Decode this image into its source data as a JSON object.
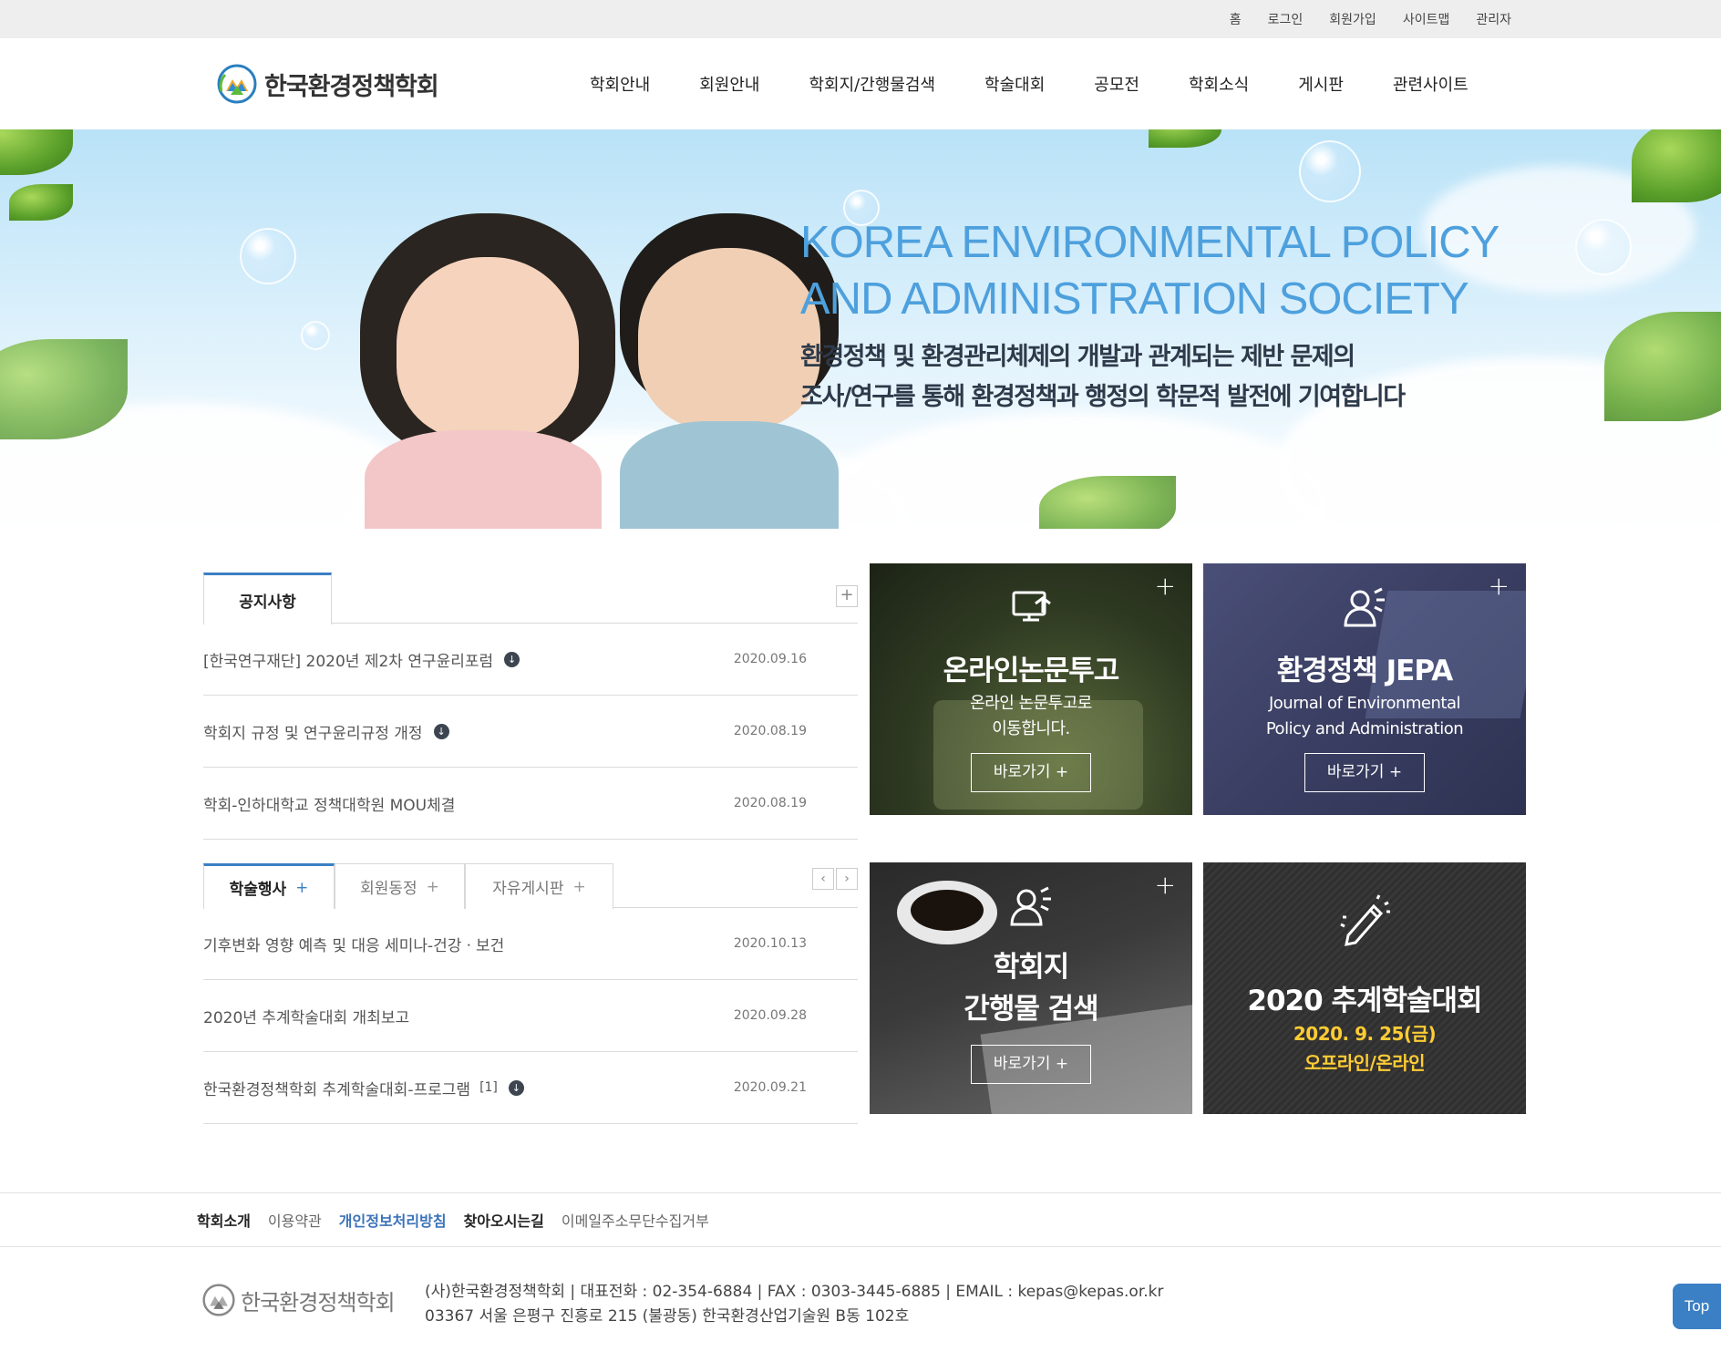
{
  "util_nav": [
    "홈",
    "로그인",
    "회원가입",
    "사이트맵",
    "관리자"
  ],
  "logo": {
    "name": "한국환경정책학회"
  },
  "gnb": [
    "학회안내",
    "회원안내",
    "학회지/간행물검색",
    "학술대회",
    "공모전",
    "학회소식",
    "게시판",
    "관련사이트"
  ],
  "hero": {
    "title_line1": "KOREA ENVIRONMENTAL POLICY",
    "title_line2": "AND ADMINISTRATION SOCIETY",
    "sub_line1": "환경정책 및 환경관리체제의 개발과 관계되는 제반 문제의",
    "sub_line2": "조사/연구를 통해 환경정책과 행정의 학문적 발전에 기여합니다"
  },
  "notice": {
    "tab": "공지사항",
    "more": "+",
    "items": [
      {
        "title": "[한국연구재단] 2020년 제2차 연구윤리포럼",
        "date": "2020.09.16",
        "has_file": true
      },
      {
        "title": "학회지 규정 및 연구윤리규정 개정",
        "date": "2020.08.19",
        "has_file": true
      },
      {
        "title": "학회-인하대학교 정책대학원 MOU체결",
        "date": "2020.08.19",
        "has_file": false
      }
    ]
  },
  "events": {
    "tabs": [
      {
        "label": "학술행사",
        "plus": "+"
      },
      {
        "label": "회원동정",
        "plus": "+"
      },
      {
        "label": "자유게시판",
        "plus": "+"
      }
    ],
    "prev": "‹",
    "next": "›",
    "items": [
      {
        "title": "기후변화 영향 예측 및 대응 세미나-건강ㆍ보건",
        "date": "2020.10.13",
        "count": "",
        "has_file": false
      },
      {
        "title": "2020년 추계학술대회 개최보고",
        "date": "2020.09.28",
        "count": "",
        "has_file": false
      },
      {
        "title": "한국환경정책학회 추계학술대회-프로그램",
        "date": "2020.09.21",
        "count": "[1]",
        "has_file": true
      }
    ]
  },
  "tiles": {
    "paper": {
      "title": "온라인논문투고",
      "desc1": "온라인 논문투고로",
      "desc2": "이동합니다.",
      "button": "바로가기 +",
      "plus": "+",
      "icon": "computer-upload-icon"
    },
    "jepa": {
      "title": "환경정책 JEPA",
      "desc1": "Journal of Environmental",
      "desc2": "Policy and Administration",
      "button": "바로가기 +",
      "plus": "+",
      "icon": "person-speaking-icon"
    },
    "journal": {
      "title1": "학회지",
      "title2": "간행물 검색",
      "button": "바로가기 +",
      "plus": "+",
      "icon": "person-search-icon"
    },
    "conference": {
      "title": "2020 추계학술대회",
      "date": "2020. 9. 25(금)",
      "mode": "오프라인/온라인",
      "icon": "pencil-icon"
    }
  },
  "footer": {
    "links": [
      {
        "label": "학회소개",
        "style": "bold"
      },
      {
        "label": "이용약관",
        "style": "normal"
      },
      {
        "label": "개인정보처리방침",
        "style": "blue"
      },
      {
        "label": "찾아오시는길",
        "style": "bold"
      },
      {
        "label": "이메일주소무단수집거부",
        "style": "normal"
      }
    ],
    "logo_name": "한국환경정책학회",
    "info_line1": "(사)한국환경정책학회 | 대표전화 : 02-354-6884 | FAX : 0303-3445-6885 | EMAIL : kepas@kepas.or.kr",
    "info_line2": "03367 서울 은평구 진흥로 215 (불광동) 한국환경산업기술원 B동 102호",
    "top_button": "Top"
  },
  "colors": {
    "accent": "#3b7fc4",
    "gold": "#ffcc33",
    "hero_title": "#4ea0dd"
  }
}
